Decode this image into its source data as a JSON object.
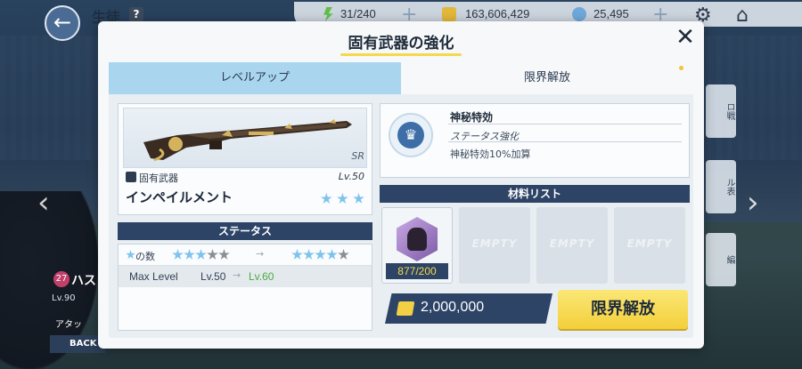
{
  "topbar": {
    "title": "生徒",
    "help": "?",
    "ap": "31/240",
    "credits": "163,606,429",
    "gems": "25,495"
  },
  "background": {
    "student_name": "ハス",
    "student_level_badge": "27",
    "student_lv": "Lv.90",
    "attack_label": "アタッ",
    "back_label": "BACK",
    "side_buttons": [
      "ロ戦",
      "ル表",
      "編"
    ]
  },
  "modal": {
    "title": "固有武器の強化",
    "tabs": [
      {
        "label": "レベルアップ",
        "active": false
      },
      {
        "label": "限界解放",
        "active": true
      }
    ],
    "weapon": {
      "rarity": "SR",
      "type_label": "固有武器",
      "level": "Lv.50",
      "name": "インペイルメント",
      "stars": 3
    },
    "status": {
      "header": "ステータス",
      "star_count_label": "の数",
      "star_from": 3,
      "star_to": 4,
      "star_total": 5,
      "max_level_label": "Max Level",
      "max_level_from": "Lv.50",
      "max_level_to": "Lv.60"
    },
    "effect": {
      "name": "神秘特効",
      "subtitle": "ステータス強化",
      "description": "神秘特効10%加算"
    },
    "materials": {
      "header": "材料リスト",
      "count": "877/200",
      "empty_label": "EMPTY"
    },
    "cost": "2,000,000",
    "action_label": "限界解放"
  },
  "colors": {
    "accent_yellow": "#f3cf3a",
    "navy": "#2d4467",
    "tab_blue": "#a9d6ee",
    "star_blue": "#7ec3ee",
    "level_green": "#4caa3e"
  }
}
